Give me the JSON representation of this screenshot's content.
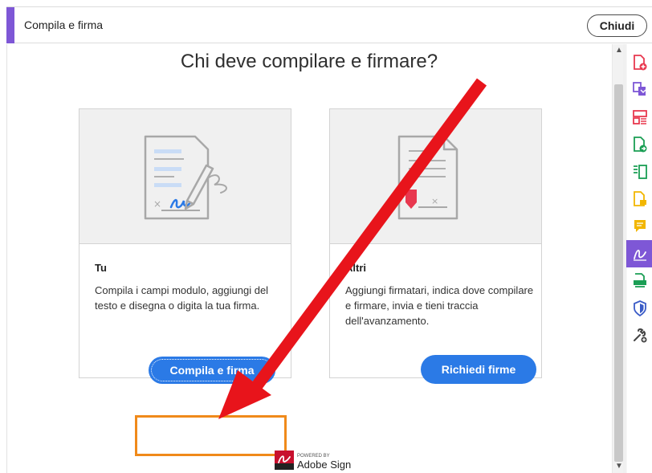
{
  "window": {
    "title": "Compila e firma",
    "close_label": "Chiudi"
  },
  "main": {
    "heading": "Chi deve compilare e firmare?",
    "cards": [
      {
        "title": "Tu",
        "description": "Compila i campi modulo, aggiungi del testo e disegna o digita la tua firma.",
        "button_label": "Compila e firma"
      },
      {
        "title": "Altri",
        "description": "Aggiungi firmatari, indica dove compilare e firmare, invia e tieni traccia dell'avanzamento.",
        "button_label": "Richiedi firme"
      }
    ],
    "powered_by": {
      "top": "POWERED BY",
      "brand": "Adobe Sign"
    }
  },
  "tools": [
    {
      "icon": "create-pdf-icon",
      "color": "#e8384f"
    },
    {
      "icon": "combine-files-icon",
      "color": "#7e57d6"
    },
    {
      "icon": "organize-pages-icon",
      "color": "#e8384f"
    },
    {
      "icon": "export-pdf-icon",
      "color": "#1a9e54"
    },
    {
      "icon": "edit-pdf-icon",
      "color": "#1a9e54"
    },
    {
      "icon": "comment-pdf-icon",
      "color": "#f2b600"
    },
    {
      "icon": "comment-icon",
      "color": "#f2b600"
    },
    {
      "icon": "fill-and-sign-icon",
      "color": "#ffffff",
      "active": true
    },
    {
      "icon": "scan-icon",
      "color": "#1a9e54"
    },
    {
      "icon": "protect-icon",
      "color": "#3a5bc7"
    },
    {
      "icon": "more-tools-icon",
      "color": "#444444"
    }
  ],
  "colors": {
    "accent": "#7e57d6",
    "primary_button": "#2b7ae6",
    "highlight": "#f08a1a",
    "annotation_arrow": "#e8141b"
  }
}
